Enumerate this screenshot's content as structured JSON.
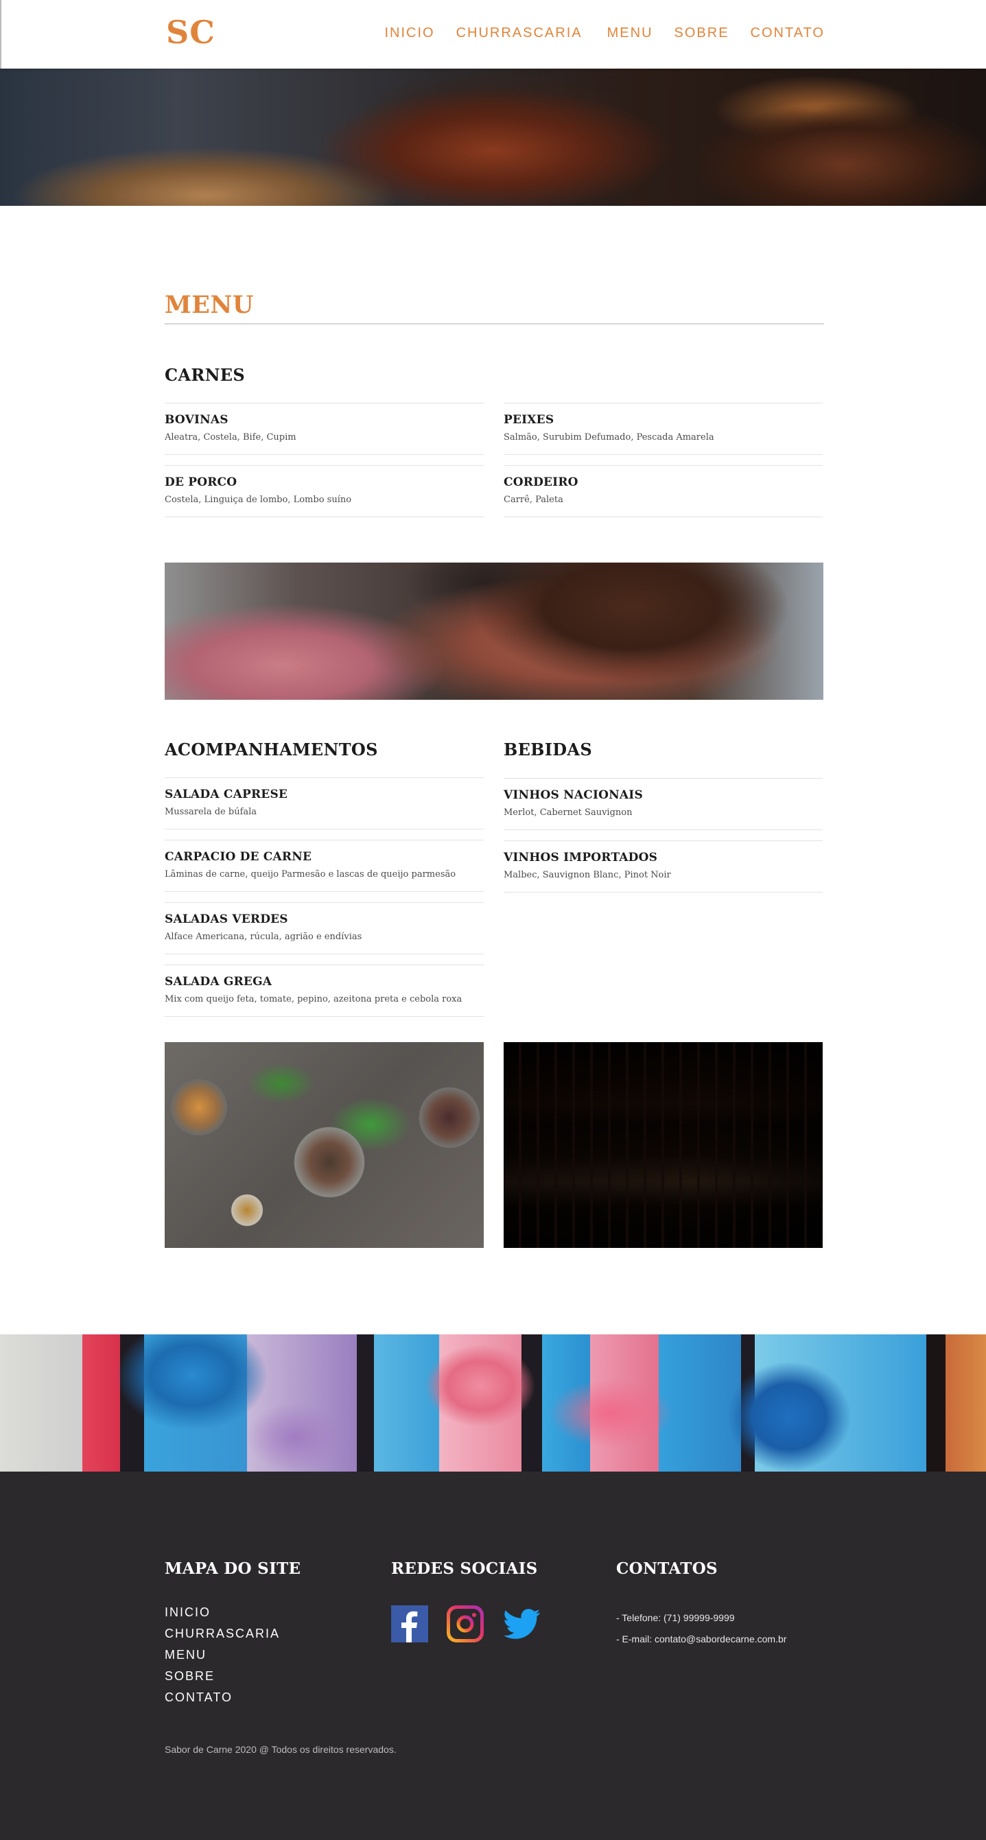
{
  "header": {
    "logo": "SC",
    "nav": [
      {
        "label": "INICIO"
      },
      {
        "label": "CHURRASCARIA"
      },
      {
        "label": "MENU"
      },
      {
        "label": "SOBRE"
      },
      {
        "label": "CONTATO"
      }
    ]
  },
  "menu": {
    "title": "MENU",
    "carnes": {
      "title": "CARNES",
      "left": [
        {
          "name": "BOVINAS",
          "desc": "Aleatra, Costela, Bife, Cupim"
        },
        {
          "name": "DE PORCO",
          "desc": "Costela, Linguiça de lombo, Lombo suíno"
        }
      ],
      "right": [
        {
          "name": "PEIXES",
          "desc": "Salmão, Surubim Defumado, Pescada Amarela"
        },
        {
          "name": "CORDEIRO",
          "desc": "Carrê, Paleta"
        }
      ]
    },
    "acompanhamentos": {
      "title": "ACOMPANHAMENTOS",
      "items": [
        {
          "name": "SALADA CAPRESE",
          "desc": "Mussarela de búfala"
        },
        {
          "name": "CARPACIO DE CARNE",
          "desc": "Lâminas de carne, queijo Parmesão e lascas de queijo parmesão"
        },
        {
          "name": "SALADAS VERDES",
          "desc": "Alface Americana, rúcula, agrião e endívias"
        },
        {
          "name": "SALADA GREGA",
          "desc": "Mix com queijo feta, tomate, pepino, azeitona preta e cebola roxa"
        }
      ]
    },
    "bebidas": {
      "title": "BEBIDAS",
      "items": [
        {
          "name": "VINHOS NACIONAIS",
          "desc": "Merlot, Cabernet Sauvignon"
        },
        {
          "name": "VINHOS IMPORTADOS",
          "desc": "Malbec, Sauvignon Blanc, Pinot Noir"
        }
      ]
    }
  },
  "footer": {
    "sitemap_title": "MAPA DO SITE",
    "sitemap": [
      "INICIO",
      "CHURRASCARIA",
      "MENU",
      "SOBRE",
      "CONTATO"
    ],
    "social_title": "REDES SOCIAIS",
    "social_icons": [
      "facebook-icon",
      "instagram-icon",
      "twitter-icon"
    ],
    "contacts_title": "CONTATOS",
    "phone": "- Telefone: (71) 99999-9999",
    "email": "- E-mail: contato@sabordecarne.com.br",
    "copyright": "Sabor de Carne 2020 @ Todos os direitos reservados."
  },
  "colors": {
    "accent": "#e1843b",
    "footer_bg": "#2b292b",
    "facebook": "#3b5ba9",
    "twitter": "#1da1f2"
  }
}
